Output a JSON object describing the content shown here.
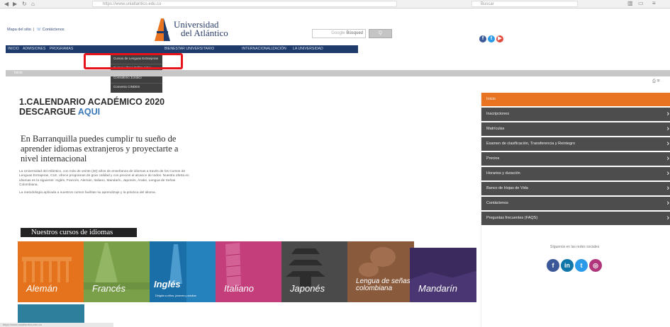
{
  "browser": {
    "url": "https://www.uniatlantico.edu.co",
    "search_placeholder": "Buscar"
  },
  "header": {
    "site_map": "Mapa del sitio",
    "contact": "Contáctenos",
    "logo_line1": "Universidad",
    "logo_line2": "del Atlántico",
    "search_brand": "Google",
    "search_placeholder": "Búsqued",
    "search_button": "Q"
  },
  "navbar": {
    "items": [
      "INICIO",
      "ADMISIONES",
      "PROGRAMAS",
      "BIENESTAR UNIVERSITARIO",
      "INTERNACIONALIZACIÓN",
      "LA UNIVERSIDAD"
    ]
  },
  "dropdown": {
    "items": [
      "Cursos de Lenguas Extranjeras",
      "Cursos Libres Bellas Artes",
      "Consultorio Jurídico",
      "Convenio CINDES"
    ]
  },
  "breadcrumb": {
    "label": "Inicio"
  },
  "main": {
    "calendar_title": "1.CALENDARIO ACADÉMICO 2020",
    "download_prefix": "DESCARGUE ",
    "download_link": "AQUI",
    "lead": "En Barranquilla puedes cumplir tu sueño de aprender idiomas extranjeros y proyectarte a nivel internacional",
    "paragraph1": "La Universidad del Atlántico, con más de veinte (20) años de enseñanza de idiomas a través de los Cursos de Lenguas Extrajeras, CLE, ofrece programas de gran calidad y con precios al alcance de todos. Nuestra oferta en idiomas es la siguiente: Inglés, Francés, Alemán, Italiano, Mandarín, Japonés, Árabe, Lengua de Señas Colombiana.",
    "paragraph2": "La metodología aplicada a nuestros cursos facilitan su aprendizaje y la práctica del idioma."
  },
  "courses": {
    "heading": "Nuestros cursos de idiomas",
    "tiles": [
      {
        "name": "Alemán",
        "color": "#e5731d"
      },
      {
        "name": "Francés",
        "color": "#7aa14a"
      },
      {
        "name": "Inglés",
        "color": "#1b6fa8",
        "subtitle": "Dirigido a niños, jóvenes y adultos"
      },
      {
        "name": "Italiano",
        "color": "#c43e7c"
      },
      {
        "name": "Japonés",
        "color": "#4a4a4a"
      },
      {
        "name": "Lengua de señas colombiana",
        "color": "#8a5a3c"
      },
      {
        "name": "Mandarín",
        "color": "#3a2a5e"
      }
    ]
  },
  "sidebar": {
    "items": [
      "Inicio",
      "Inscripciones",
      "Matrículas",
      "Examen de clasificación, Transferencia y Reintegro",
      "Precios",
      "Horarios y duración",
      "Banco de Hojas de Vida",
      "Contáctenos",
      "Preguntas frecuentes (FAQS)"
    ],
    "follow": "Síguenos en las redes sociales"
  },
  "colors": {
    "navy": "#1e3b6b",
    "orange": "#e87421",
    "menu_gray": "#4d4d4d",
    "highlight_red": "#e8121a"
  }
}
